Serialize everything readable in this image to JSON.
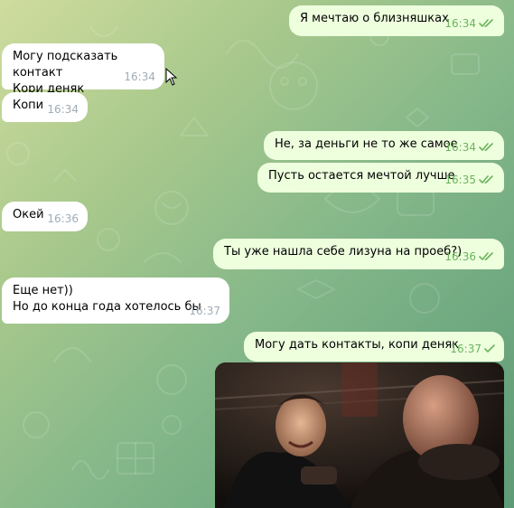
{
  "messages": [
    {
      "dir": "out",
      "text": "Я мечтаю о близняшках",
      "time": "16:34",
      "status": "read"
    },
    {
      "dir": "in",
      "text": "Могу подсказать контакт\nКори деняк",
      "time": "16:34"
    },
    {
      "dir": "in",
      "text": "Копи",
      "time": "16:34"
    },
    {
      "dir": "out",
      "text": "Не, за деньги не то же самое",
      "time": "16:34",
      "status": "read"
    },
    {
      "dir": "out",
      "text": "Пусть остается мечтой лучше",
      "time": "16:35",
      "status": "read"
    },
    {
      "dir": "in",
      "text": "Окей",
      "time": "16:36"
    },
    {
      "dir": "out",
      "text": "Ты уже нашла себе лизуна на проеб?)",
      "time": "16:36",
      "status": "read"
    },
    {
      "dir": "in",
      "text": "Еще нет))\nНо до конца года хотелось бы",
      "time": "16:37"
    },
    {
      "dir": "out",
      "text": "Могу дать контакты, копи деняк",
      "time": "16:37",
      "status": "sent"
    }
  ],
  "colors": {
    "incoming_bubble": "#ffffff",
    "outgoing_bubble": "#eeffde",
    "outgoing_meta": "#6cb35e",
    "incoming_meta": "#a0acb6"
  },
  "icons": {
    "read": "double-check-icon",
    "sent": "single-check-icon"
  }
}
